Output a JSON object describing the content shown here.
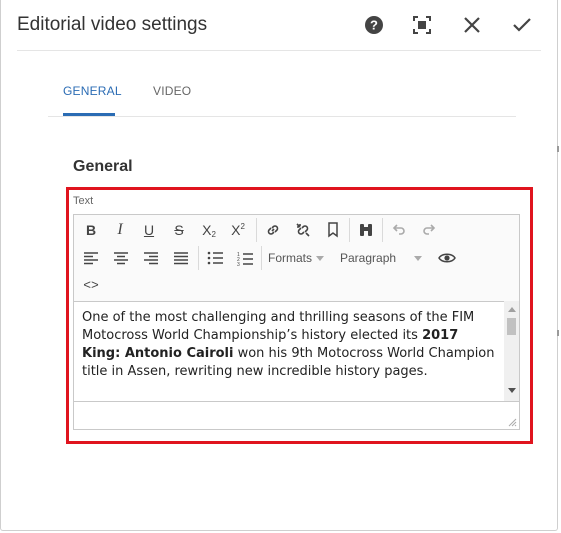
{
  "dialog": {
    "title": "Editorial video settings",
    "actions": {
      "help_icon": "help-circle-icon",
      "fullscreen_icon": "fullscreen-icon",
      "close_icon": "close-icon",
      "done_icon": "checkmark-icon"
    }
  },
  "tabs": [
    {
      "label": "GENERAL",
      "active": true
    },
    {
      "label": "VIDEO",
      "active": false
    }
  ],
  "section": {
    "title": "General"
  },
  "field": {
    "label": "Text"
  },
  "toolbar": {
    "formats_label": "Formats",
    "paragraph_label": "Paragraph",
    "icons": [
      "bold-icon",
      "italic-icon",
      "underline-icon",
      "strikethrough-icon",
      "subscript-icon",
      "superscript-icon",
      "link-icon",
      "unlink-icon",
      "bookmark-icon",
      "find-icon",
      "undo-icon",
      "redo-icon",
      "align-left-icon",
      "align-center-icon",
      "align-right-icon",
      "align-justify-icon",
      "bullet-list-icon",
      "numbered-list-icon",
      "preview-icon",
      "source-code-icon"
    ]
  },
  "editor": {
    "text_before": "One of the most challenging and thrilling seasons of the FIM Motocross World Championship’s history elected its ",
    "text_bold": "2017 King: Antonio Cairoli",
    "text_after": " won his 9th Motocross World Champion title in Assen, rewriting new incredible history pages."
  },
  "colors": {
    "accent": "#2b6cb4",
    "highlight": "#e0141e"
  }
}
